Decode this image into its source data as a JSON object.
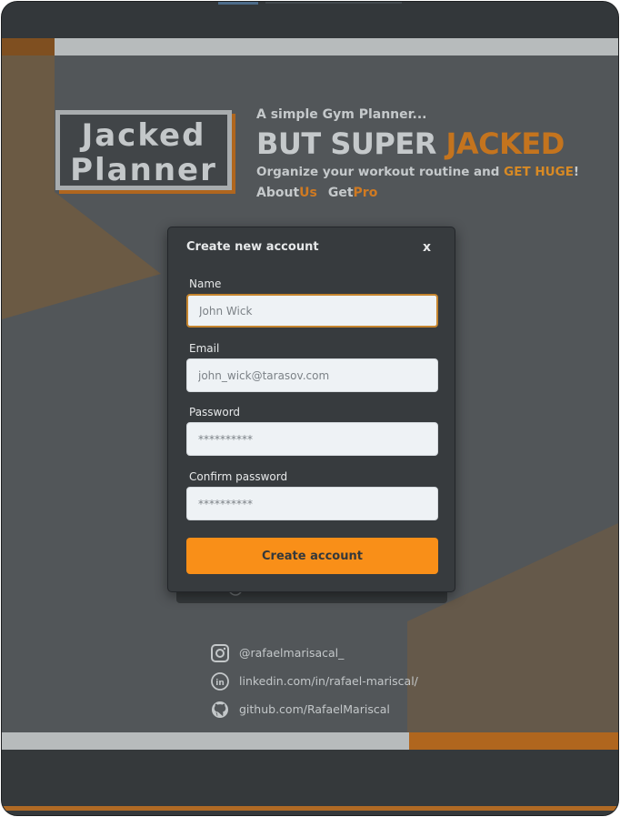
{
  "brand": {
    "logo_line1": "Jacked",
    "logo_line2": "Planner",
    "tagline": "A simple Gym Planner...",
    "headline_part1": "BUT SUPER ",
    "headline_accent": "JACKED",
    "subline_part1": "Organize your workout routine and ",
    "subline_accent": "GET HUGE",
    "subline_end": "!",
    "link_about": "About",
    "link_about_accent": "Us",
    "link_get": "Get",
    "link_get_accent": "Pro"
  },
  "modal": {
    "title": "Create new account",
    "close_label": "x",
    "name_label": "Name",
    "name_placeholder": "John Wick",
    "email_label": "Email",
    "email_placeholder": "john_wick@tarasov.com",
    "password_label": "Password",
    "password_placeholder": "**********",
    "confirm_label": "Confirm password",
    "confirm_placeholder": "**********",
    "submit_label": "Create account"
  },
  "socials": {
    "instagram": "@rafaelmarisacal_",
    "linkedin": "linkedin.com/in/rafael-mariscal/",
    "github": "github.com/RafaelMariscal"
  },
  "colors": {
    "accent": "#f98f18",
    "background": "#525659",
    "dark": "#35393b"
  }
}
